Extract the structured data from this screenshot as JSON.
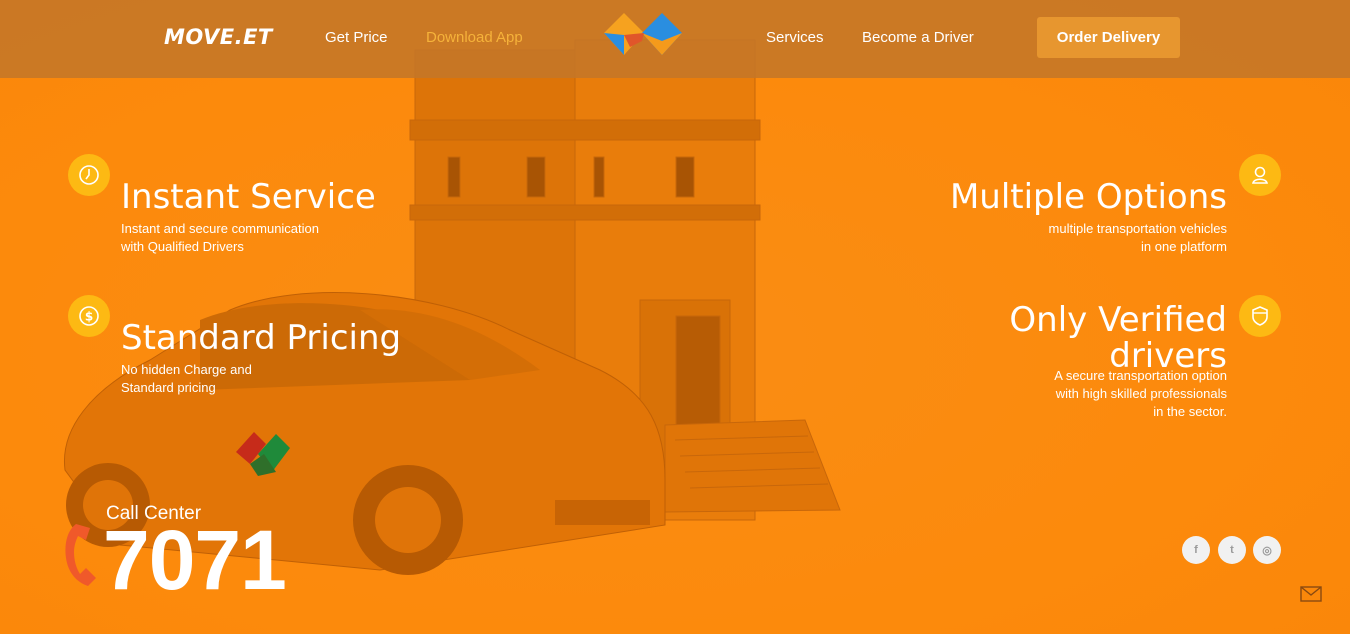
{
  "header": {
    "brand": "MOVE.ET",
    "nav": [
      {
        "label": "Get Price"
      },
      {
        "label": "Download App"
      },
      {
        "label": "Services"
      },
      {
        "label": "Become a Driver"
      }
    ],
    "cta": "Order Delivery",
    "active_color": "#f5b23a"
  },
  "features": {
    "instant": {
      "title": "Instant Service",
      "desc": "Instant and secure communication\nwith Qualified Drivers",
      "icon": "clock-icon"
    },
    "pricing": {
      "title": "Standard Pricing",
      "desc": "No hidden Charge and\nStandard pricing",
      "icon": "dollar-icon"
    },
    "options": {
      "title": "Multiple Options",
      "desc": "multiple transportation vehicles\nin one platform",
      "icon": "user-icon"
    },
    "verified": {
      "title_line1": "Only Verified",
      "title_line2": "drivers",
      "desc": "A secure transportation option\nwith high skilled professionals\nin the sector.",
      "icon": "shield-icon"
    }
  },
  "call_center": {
    "label": "Call Center",
    "number": "7071"
  },
  "social": [
    {
      "icon": "facebook-icon",
      "glyph": "f"
    },
    {
      "icon": "twitter-icon",
      "glyph": "t"
    },
    {
      "icon": "instagram-icon",
      "glyph": "◎"
    }
  ],
  "colors": {
    "background": "#fb8a0f",
    "header": "#c47628",
    "accent": "#fdb913",
    "button": "#e7962f"
  }
}
